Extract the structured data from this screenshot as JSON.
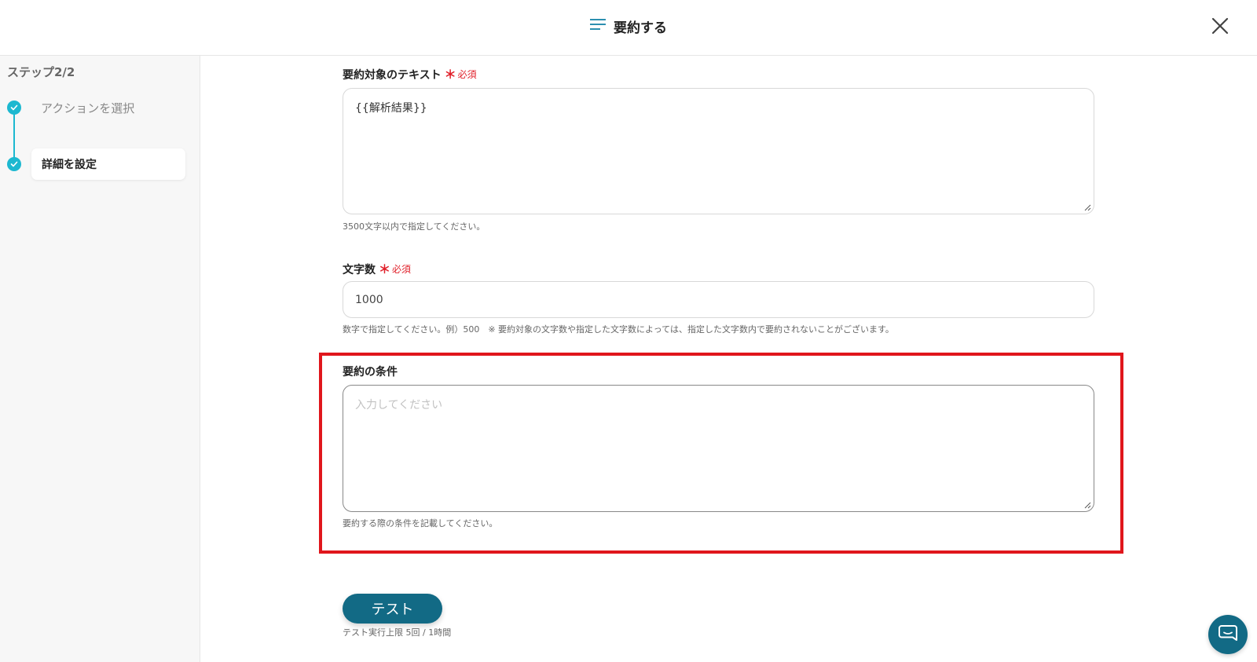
{
  "header": {
    "title": "要約する",
    "icon": "summary-lines-icon",
    "close_icon": "close-icon"
  },
  "sidebar": {
    "step_count": "ステップ2/2",
    "steps": [
      {
        "label": "アクションを選択",
        "status": "completed"
      },
      {
        "label": "詳細を設定",
        "status": "active"
      }
    ]
  },
  "form": {
    "text_field": {
      "label": "要約対象のテキスト",
      "required_mark": "＊",
      "required_label": "必須",
      "value": "{{解析結果}}",
      "help": "3500文字以内で指定してください。"
    },
    "char_count": {
      "label": "文字数",
      "required_mark": "＊",
      "required_label": "必須",
      "value": "1000",
      "help": "数字で指定してください。例）500　※ 要約対象の文字数や指定した文字数によっては、指定した文字数内で要約されないことがございます。"
    },
    "conditions": {
      "label": "要約の条件",
      "placeholder": "入力してください",
      "help": "要約する際の条件を記載してください。"
    }
  },
  "actions": {
    "test_label": "テスト",
    "test_limit": "テスト実行上限 5回 / 1時間"
  },
  "colors": {
    "accent": "#1cb8d0",
    "primary_button": "#126a85",
    "required": "#e0202a",
    "highlight_border": "#e0161c"
  }
}
